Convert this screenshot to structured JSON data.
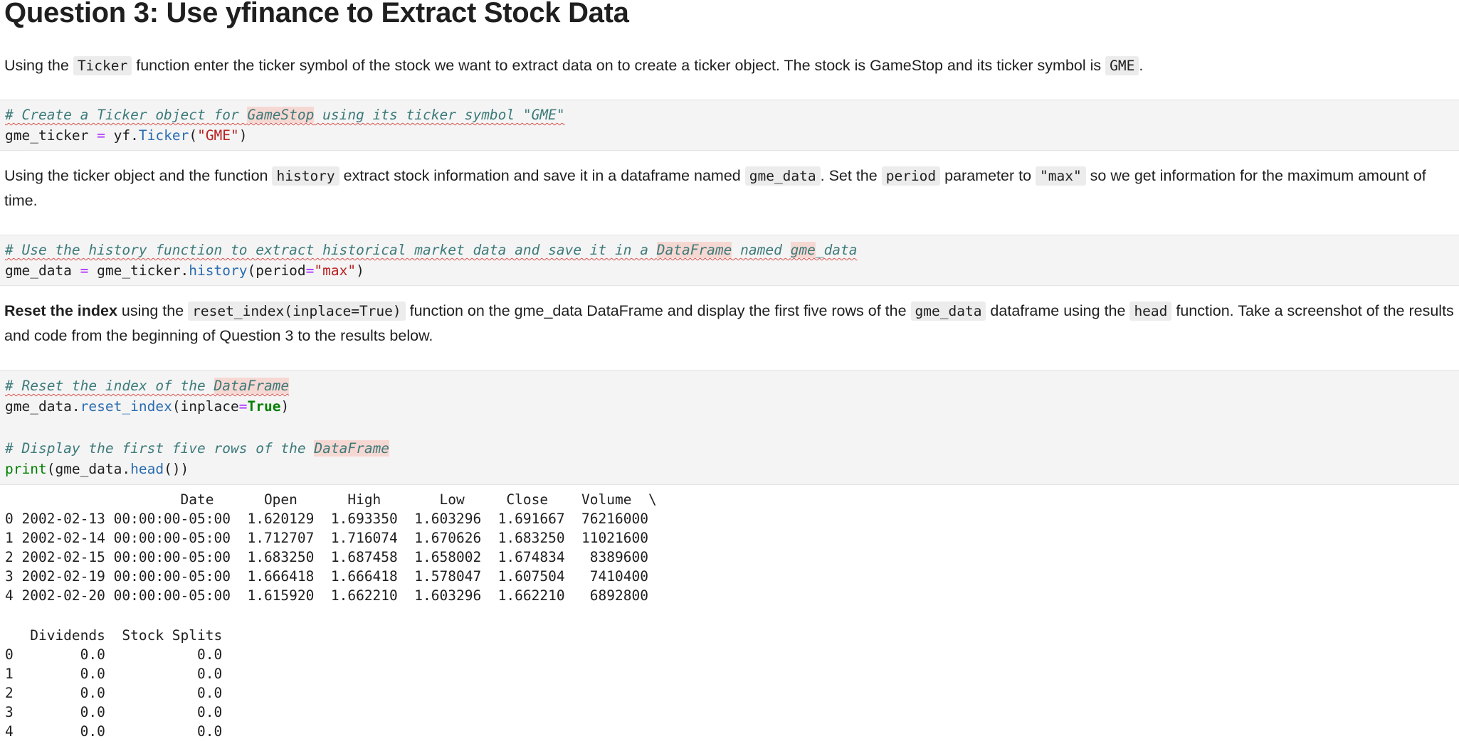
{
  "heading": "Question 3: Use yfinance to Extract Stock Data",
  "para1": {
    "t1": "Using the ",
    "c1": "Ticker",
    "t2": " function enter the ticker symbol of the stock we want to extract data on to create a ticker object. The stock is GameStop and its ticker symbol is ",
    "c2": "GME",
    "t3": "."
  },
  "cell1": {
    "comment_a": "# Create a Ticker object for ",
    "comment_hl": "GameStop",
    "comment_b": " using its ticker symbol \"GME\"",
    "var": "gme_ticker",
    "eq": " = ",
    "mod": "yf.",
    "fn": "Ticker",
    "open": "(",
    "arg": "\"GME\"",
    "close": ")"
  },
  "para2": {
    "t1": "Using the ticker object and the function ",
    "c1": "history",
    "t2": " extract stock information and save it in a dataframe named ",
    "c2": "gme_data",
    "t3": ". Set the ",
    "c3": "period",
    "t4": " parameter to ",
    "c4": "\"max\"",
    "t5": " so we get information for the maximum amount of time."
  },
  "cell2": {
    "comment_a": "# Use the history function to extract historical market data and save it in a ",
    "comment_hl1": "DataFrame",
    "comment_b": " named ",
    "comment_hl2": "gme",
    "comment_c": "_data",
    "var": "gme_data",
    "eq": " = ",
    "obj": "gme_ticker.",
    "fn": "history",
    "open": "(period",
    "eq2": "=",
    "arg": "\"max\"",
    "close": ")"
  },
  "para3": {
    "b1": "Reset the index",
    "t1": " using the ",
    "c1": "reset_index(inplace=True)",
    "t2": " function on the gme_data DataFrame and display the first five rows of the ",
    "c2": "gme_data",
    "t3": " dataframe using the ",
    "c3": "head",
    "t4": " function. Take a screenshot of the results and code from the beginning of Question 3 to the results below."
  },
  "cell3": {
    "c1_a": "# Reset the index of the ",
    "c1_hl": "DataFrame",
    "l2_obj": "gme_data.",
    "l2_fn": "reset_index",
    "l2_open": "(inplace",
    "l2_eq": "=",
    "l2_kw": "True",
    "l2_close": ")",
    "c2_a": "# Display the first five rows of the ",
    "c2_hl": "DataFrame",
    "l4_bi": "print",
    "l4_a": "(gme_data.",
    "l4_fn": "head",
    "l4_b": "())"
  },
  "output": {
    "block1": "                     Date      Open      High       Low     Close    Volume  \\\n0 2002-02-13 00:00:00-05:00  1.620129  1.693350  1.603296  1.691667  76216000   \n1 2002-02-14 00:00:00-05:00  1.712707  1.716074  1.670626  1.683250  11021600   \n2 2002-02-15 00:00:00-05:00  1.683250  1.687458  1.658002  1.674834   8389600   \n3 2002-02-19 00:00:00-05:00  1.666418  1.666418  1.578047  1.607504   7410400   \n4 2002-02-20 00:00:00-05:00  1.615920  1.662210  1.603296  1.662210   6892800   ",
    "block2": "   Dividends  Stock Splits  \n0        0.0           0.0  \n1        0.0           0.0  \n2        0.0           0.0  \n3        0.0           0.0  \n4        0.0           0.0  "
  }
}
